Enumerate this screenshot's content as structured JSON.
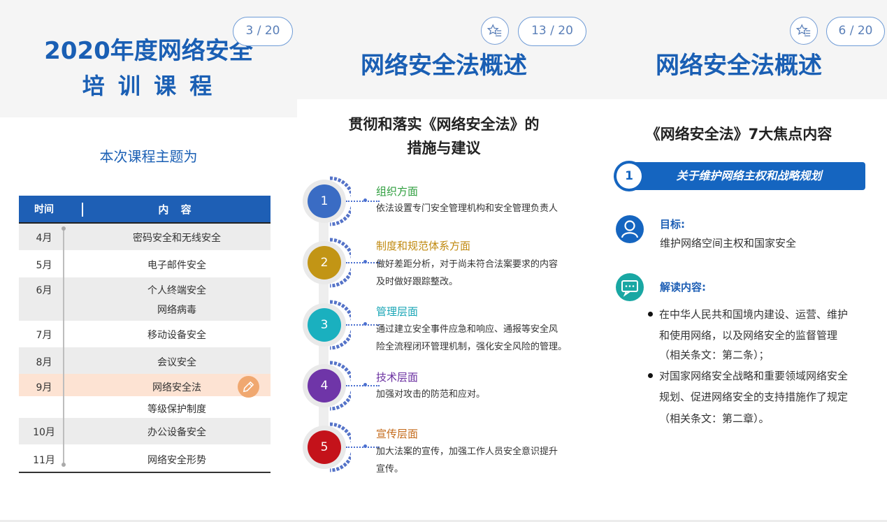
{
  "slide1": {
    "title_line1": "2020年度网络安全",
    "title_line2": "培 训 课 程",
    "page_indicator": "3 / 20",
    "subtitle": "本次课程主题为",
    "table": {
      "header_time": "时间",
      "header_content": "内 容",
      "rows": [
        {
          "month": "4月",
          "content": "密码安全和无线安全"
        },
        {
          "month": "5月",
          "content": "电子邮件安全"
        },
        {
          "month": "6月",
          "content": "个人终端安全",
          "content2": "网络病毒"
        },
        {
          "month": "7月",
          "content": "移动设备安全"
        },
        {
          "month": "8月",
          "content": "会议安全"
        },
        {
          "month": "9月",
          "content": "网络安全法",
          "content2": "等级保护制度"
        },
        {
          "month": "10月",
          "content": "办公设备安全"
        },
        {
          "month": "11月",
          "content": "网络安全形势"
        }
      ]
    },
    "highlight_color": "#fde3d3"
  },
  "slide2": {
    "title": "网络安全法概述",
    "page_indicator": "13 / 20",
    "heading_line1": "贯彻和落实《网络安全法》的",
    "heading_line2": "措施与建议",
    "items": [
      {
        "num": "1",
        "title": "组织方面",
        "text1": "依法设置专门安全管理机构和安全管理负责人",
        "color": "#3a6cc4",
        "title_color": "#2e9e3e"
      },
      {
        "num": "2",
        "title": "制度和规范体系方面",
        "text1": "做好差距分析，对于尚未符合法案要求的内容",
        "text2": "及时做好跟踪整改。",
        "color": "#c29515",
        "title_color": "#c08a10"
      },
      {
        "num": "3",
        "title": "管理层面",
        "text1": "通过建立安全事件应急和响应、通报等安全风",
        "text2": "险全流程闭环管理机制，强化安全风险的管理。",
        "color": "#1ab0bf",
        "title_color": "#1aa6b6"
      },
      {
        "num": "4",
        "title": "技术层面",
        "text1": "加强对攻击的防范和应对。",
        "color": "#6f35a8",
        "title_color": "#6a2fa0"
      },
      {
        "num": "5",
        "title": "宣传层面",
        "text1": "加大法案的宣传，加强工作人员安全意识提升",
        "text2": "宣传。",
        "color": "#c4121a",
        "title_color": "#c46a1a"
      }
    ]
  },
  "slide3": {
    "title": "网络安全法概述",
    "page_indicator": "6 / 20",
    "heading": "《网络安全法》7大焦点内容",
    "banner_num": "1",
    "banner_text": "关于维护网络主权和战略规划",
    "goal_label": "目标:",
    "goal_text": "维护网络空间主权和国家安全",
    "interp_label": "解读内容:",
    "bullets": [
      {
        "line1": "在中华人民共和国境内建设、运营、维护",
        "line2": "和使用网络，以及网络安全的监督管理",
        "line3": "（相关条文：第二条）；"
      },
      {
        "line1": "对国家网络安全战略和重要领域网络安全",
        "line2": "规划、促进网络安全的支持措施作了规定",
        "line3": "（相关条文：第二章）。"
      }
    ],
    "accent_color": "#1565c0",
    "icons": {
      "goal": "person-icon",
      "interp": "chat-icon"
    }
  }
}
